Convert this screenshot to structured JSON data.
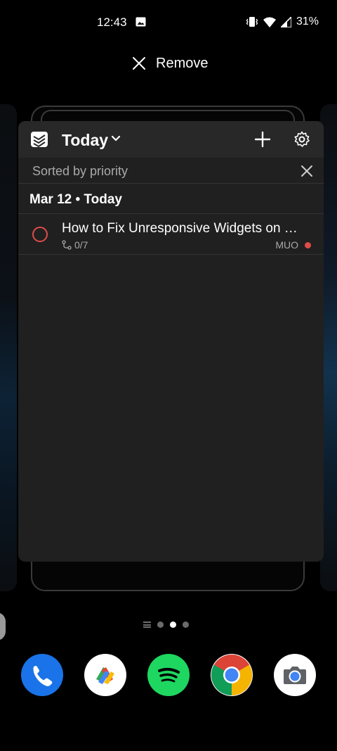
{
  "status_bar": {
    "time": "12:43",
    "battery": "31%"
  },
  "remove": {
    "label": "Remove"
  },
  "widget": {
    "title": "Today",
    "sort_label": "Sorted by priority",
    "date_header": "Mar 12 • Today",
    "task": {
      "title": "How to Fix Unresponsive Widgets on …",
      "subtasks": "0/7",
      "project": "MUO"
    }
  },
  "colors": {
    "priority_red": "#de4c4a",
    "phone_blue": "#1a73e8",
    "spotify_green": "#1ed760"
  },
  "dock": {
    "apps": [
      "phone-icon",
      "google-pay-icon",
      "spotify-icon",
      "chrome-icon",
      "camera-icon"
    ]
  }
}
